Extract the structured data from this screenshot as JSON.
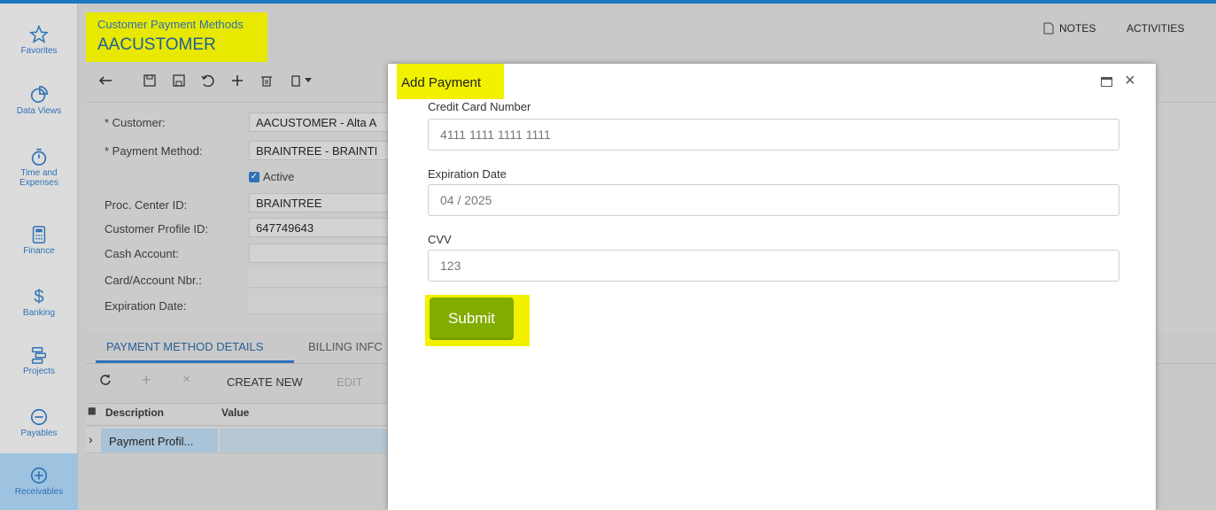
{
  "header": {
    "subtitle": "Customer Payment Methods",
    "title": "AACUSTOMER",
    "notes_label": "NOTES",
    "activities_label": "ACTIVITIES"
  },
  "sidebar": {
    "items": [
      {
        "label": "Favorites",
        "icon": "star-icon"
      },
      {
        "label": "Data Views",
        "icon": "pie-chart-icon"
      },
      {
        "label": "Time and Expenses",
        "icon": "stopwatch-icon"
      },
      {
        "label": "Finance",
        "icon": "calculator-icon"
      },
      {
        "label": "Banking",
        "icon": "dollar-icon"
      },
      {
        "label": "Projects",
        "icon": "projects-icon"
      },
      {
        "label": "Payables",
        "icon": "minus-circle-icon"
      },
      {
        "label": "Receivables",
        "icon": "plus-circle-icon"
      }
    ]
  },
  "form": {
    "customer_label": "Customer:",
    "customer_value": "AACUSTOMER - Alta A",
    "payment_method_label": "Payment Method:",
    "payment_method_value": "BRAINTREE - BRAINTI",
    "active_label": "Active",
    "proc_center_label": "Proc. Center ID:",
    "proc_center_value": "BRAINTREE",
    "customer_profile_label": "Customer Profile ID:",
    "customer_profile_value": "647749643",
    "cash_account_label": "Cash Account:",
    "card_account_label": "Card/Account Nbr.:",
    "expiration_label": "Expiration Date:"
  },
  "tabs": {
    "details": "PAYMENT METHOD DETAILS",
    "billing": "BILLING INFC"
  },
  "grid": {
    "create_new": "CREATE NEW",
    "edit": "EDIT",
    "col_description": "Description",
    "col_value": "Value",
    "row_description": "Payment Profil..."
  },
  "modal": {
    "title": "Add Payment",
    "card_number_label": "Credit Card Number",
    "card_number_placeholder": "4111 1111 1111 1111",
    "expiration_label": "Expiration Date",
    "expiration_placeholder": "04 / 2025",
    "cvv_label": "CVV",
    "cvv_placeholder": "123",
    "submit_label": "Submit"
  },
  "colors": {
    "accent": "#2f72b6",
    "highlight": "#f1f100",
    "submit": "#83ac00"
  }
}
